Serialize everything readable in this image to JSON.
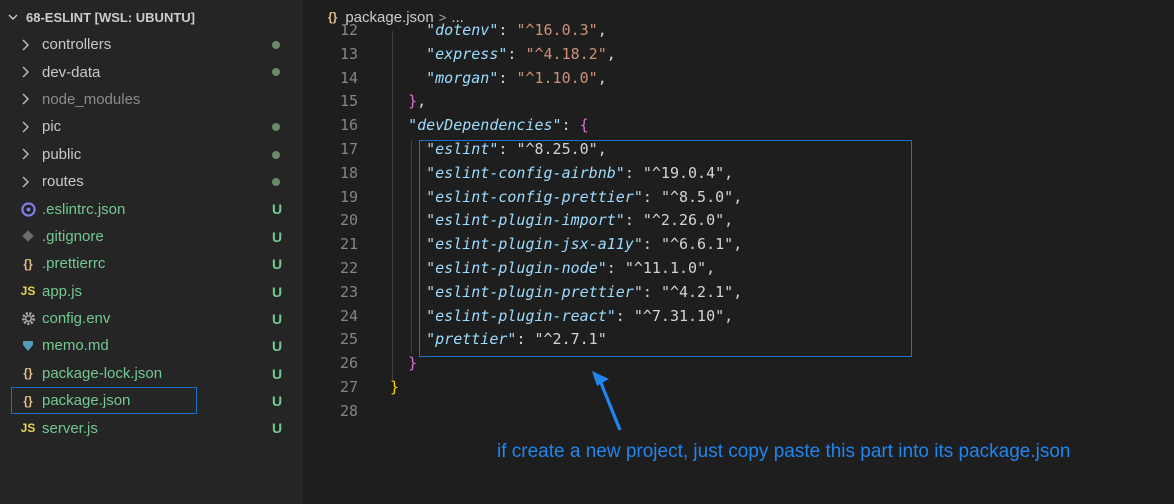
{
  "explorer": {
    "title": "68-ESLINT [WSL: UBUNTU]",
    "items": [
      {
        "label": "controllers",
        "type": "folder",
        "status": "dot"
      },
      {
        "label": "dev-data",
        "type": "folder",
        "status": "dot"
      },
      {
        "label": "node_modules",
        "type": "folder",
        "status": "",
        "dim": true
      },
      {
        "label": "pic",
        "type": "folder",
        "status": "dot"
      },
      {
        "label": "public",
        "type": "folder",
        "status": "dot"
      },
      {
        "label": "routes",
        "type": "folder",
        "status": "dot"
      },
      {
        "label": ".eslintrc.json",
        "type": "file",
        "icon": "eslint-icon",
        "status": "U"
      },
      {
        "label": ".gitignore",
        "type": "file",
        "icon": "git-icon",
        "status": "U"
      },
      {
        "label": ".prettierrc",
        "type": "file",
        "icon": "json-icon",
        "status": "U"
      },
      {
        "label": "app.js",
        "type": "file",
        "icon": "js-icon",
        "status": "U"
      },
      {
        "label": "config.env",
        "type": "file",
        "icon": "gear-icon",
        "status": "U"
      },
      {
        "label": "memo.md",
        "type": "file",
        "icon": "markdown-icon",
        "status": "U"
      },
      {
        "label": "package-lock.json",
        "type": "file",
        "icon": "json-icon",
        "status": "U"
      },
      {
        "label": "package.json",
        "type": "file",
        "icon": "json-icon",
        "status": "U",
        "selected": true
      },
      {
        "label": "server.js",
        "type": "file",
        "icon": "js-icon",
        "status": "U"
      }
    ]
  },
  "editor": {
    "breadcrumb_file": "package.json",
    "breadcrumb_sep": ">",
    "breadcrumb_more": "...",
    "line_numbers": [
      "12",
      "13",
      "14",
      "15",
      "16",
      "17",
      "18",
      "19",
      "20",
      "21",
      "22",
      "23",
      "24",
      "25",
      "26",
      "27",
      "28"
    ],
    "dependencies_tail": [
      {
        "key": "\"dotenv\"",
        "value": "\"^16.0.3\""
      },
      {
        "key": "\"express\"",
        "value": "\"^4.18.2\""
      },
      {
        "key": "\"morgan\"",
        "value": "\"^1.10.0\""
      }
    ],
    "devDependencies_key": "\"devDependencies\"",
    "devDependencies": [
      {
        "key": "\"eslint\"",
        "value": "\"^8.25.0\""
      },
      {
        "key": "\"eslint-config-airbnb\"",
        "value": "\"^19.0.4\""
      },
      {
        "key": "\"eslint-config-prettier\"",
        "value": "\"^8.5.0\""
      },
      {
        "key": "\"eslint-plugin-import\"",
        "value": "\"^2.26.0\""
      },
      {
        "key": "\"eslint-plugin-jsx-a11y\"",
        "value": "\"^6.6.1\""
      },
      {
        "key": "\"eslint-plugin-node\"",
        "value": "\"^11.1.0\""
      },
      {
        "key": "\"eslint-plugin-prettier\"",
        "value": "\"^4.2.1\""
      },
      {
        "key": "\"eslint-plugin-react\"",
        "value": "\"^7.31.10\""
      },
      {
        "key": "\"prettier\"",
        "value": "\"^2.7.1\""
      }
    ]
  },
  "annotation": {
    "text": "if create a new project, just copy paste this part into its package.json"
  },
  "colors": {
    "key": "#9cdcfe",
    "string": "#ce9178",
    "accent": "#1f70c8",
    "annotation": "#1f86f0",
    "untracked": "#73c991"
  }
}
